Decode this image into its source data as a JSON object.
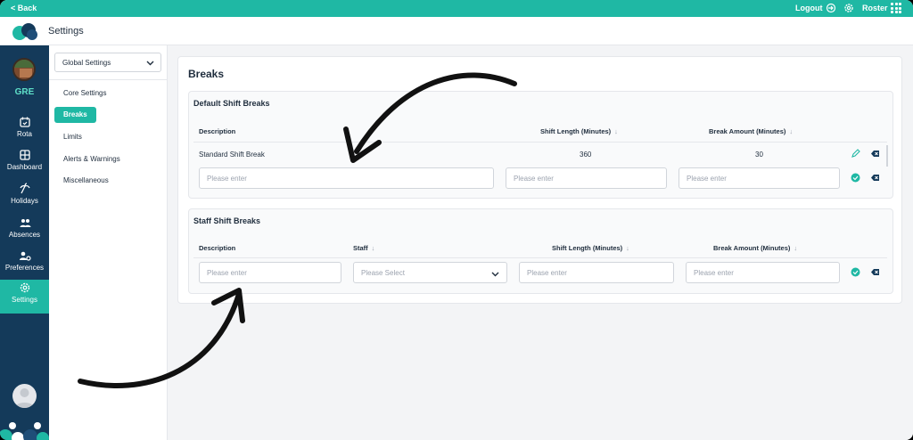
{
  "topbar": {
    "back": "< Back",
    "logout": "Logout",
    "roster": "Roster"
  },
  "header": {
    "title": "Settings"
  },
  "rail": {
    "org": "GRE",
    "items": [
      {
        "label": "Rota",
        "icon": "calendar-icon"
      },
      {
        "label": "Dashboard",
        "icon": "dashboard-icon"
      },
      {
        "label": "Holidays",
        "icon": "holiday-icon"
      },
      {
        "label": "Absences",
        "icon": "absences-icon"
      },
      {
        "label": "Preferences",
        "icon": "preferences-icon"
      },
      {
        "label": "Settings",
        "icon": "settings-icon",
        "active": true
      }
    ]
  },
  "sidebar": {
    "select_value": "Global Settings",
    "items": [
      {
        "label": "Core Settings"
      },
      {
        "label": "Breaks",
        "active": true
      },
      {
        "label": "Limits"
      },
      {
        "label": "Alerts & Warnings"
      },
      {
        "label": "Miscellaneous"
      }
    ]
  },
  "main": {
    "heading": "Breaks",
    "default": {
      "title": "Default Shift Breaks",
      "headers": {
        "description": "Description",
        "shift_length": "Shift Length (Minutes)",
        "break_amount": "Break Amount (Minutes)",
        "arrow": "↓"
      },
      "row": {
        "description": "Standard Shift Break",
        "shift_length": "360",
        "break_amount": "30"
      },
      "placeholders": {
        "description": "Please enter",
        "shift_length": "Please enter",
        "break_amount": "Please enter"
      }
    },
    "staff": {
      "title": "Staff Shift Breaks",
      "headers": {
        "description": "Description",
        "staff": "Staff",
        "shift_length": "Shift Length (Minutes)",
        "break_amount": "Break Amount (Minutes)",
        "arrow": "↓"
      },
      "placeholders": {
        "description": "Please enter",
        "staff": "Please Select",
        "shift_length": "Please enter",
        "break_amount": "Please enter"
      }
    }
  },
  "colors": {
    "accent": "#1fb8a4",
    "rail": "#143a5a"
  }
}
